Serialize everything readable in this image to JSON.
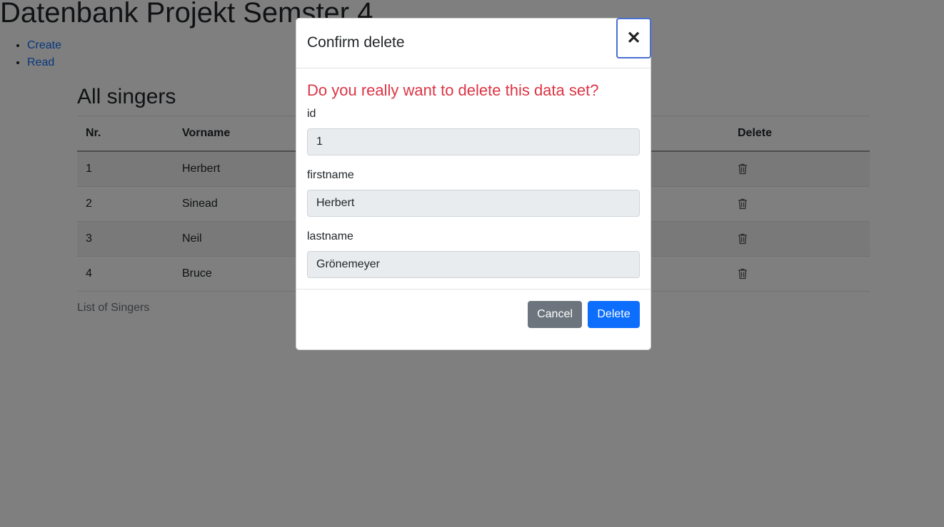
{
  "site": {
    "title": "Datenbank Projekt Semster 4"
  },
  "nav": {
    "items": [
      {
        "label": "Create"
      },
      {
        "label": "Read"
      }
    ]
  },
  "main": {
    "heading": "All singers",
    "table": {
      "headers": [
        "Nr.",
        "Vorname",
        "",
        "Delete"
      ],
      "rows": [
        {
          "nr": "1",
          "firstname": "Herbert"
        },
        {
          "nr": "2",
          "firstname": "Sinead"
        },
        {
          "nr": "3",
          "firstname": "Neil"
        },
        {
          "nr": "4",
          "firstname": "Bruce"
        }
      ],
      "delete_icon": "trash-icon"
    },
    "caption": "List of Singers"
  },
  "modal": {
    "title": "Confirm delete",
    "close_icon": "close-icon",
    "warning": "Do you really want to delete this data set?",
    "fields": [
      {
        "label": "id",
        "value": "1"
      },
      {
        "label": "firstname",
        "value": "Herbert"
      },
      {
        "label": "lastname",
        "value": "Grönemeyer"
      }
    ],
    "cancel_label": "Cancel",
    "delete_label": "Delete"
  },
  "colors": {
    "link": "#0d6efd",
    "warning": "#dc3545",
    "primary_button": "#0d6efd",
    "secondary_button": "#6c757d",
    "backdrop": "rgba(0,0,0,0.5)"
  }
}
